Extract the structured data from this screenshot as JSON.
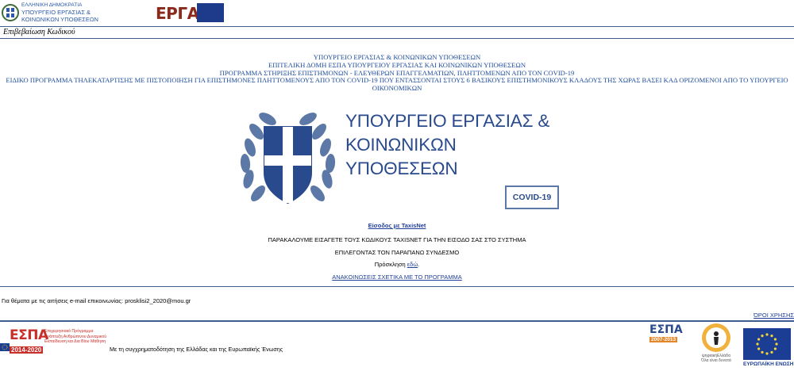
{
  "header": {
    "ministry_line1": "ΕΛΛΗΝΙΚΗ ΔΗΜΟΚΡΑΤΙΑ",
    "ministry_line2": "ΥΠΟΥΡΓΕΙΟ ΕΡΓΑΣΙΑΣ &",
    "ministry_line3": "ΚΟΙΝΩΝΙΚΩΝ ΥΠΟΘΕΣΕΩΝ",
    "ergani_logo_text": "ΕΡΓΑΝΗ"
  },
  "page_heading": "Επιβεβαίωση Κωδικού",
  "titles": {
    "line1": "ΥΠΟΥΡΓΕΙΟ ΕΡΓΑΣΙΑΣ & ΚΟΙΝΩΝΙΚΩΝ ΥΠΟΘΕΣΕΩΝ",
    "line2": "ΕΠΙΤΕΛΙΚΗ ΔΟΜΗ ΕΣΠΑ ΥΠΟΥΡΓΕΙΟΥ ΕΡΓΑΣΙΑΣ ΚΑΙ ΚΟΙΝΩΝΙΚΩΝ ΥΠΟΘΕΣΕΩΝ",
    "line3": "ΠΡΟΓΡΑΜΜΑ ΣΤΗΡΙΞΗΣ ΕΠΙΣΤΗΜΟΝΩΝ - ΕΛΕΥΘΕΡΩΝ ΕΠΑΓΓΕΛΜΑΤΙΩΝ, ΠΛΗΤΤΟΜΕΝΩΝ ΑΠΟ ΤΟΝ COVID-19",
    "line4": "ΕΙΔΙΚΟ ΠΡΟΓΡΑΜΜΑ ΤΗΛΕΚΑΤΑΡΤΙΣΗΣ ΜΕ ΠΙΣΤΟΠΟΙΗΣΗ ΓΙΑ ΕΠΙΣΤΗΜΟΝΕΣ ΠΛΗΤΤΟΜΕΝΟΥΣ ΑΠΟ ΤΟΝ COVID-19 ΠΟΥ ΕΝΤΑΣΣΟΝΤΑΙ ΣΤΟΥΣ 6 ΒΑΣΙΚΟΥΣ ΕΠΙΣΤΗΜΟΝΙΚΟΥΣ ΚΛΑΔΟΥΣ ΤΗΣ ΧΩΡΑΣ ΒΑΣΕΙ ΚΑΔ ΟΡΙΖΟΜΕΝΟΙ ΑΠΟ ΤΟ ΥΠΟΥΡΓΕΙΟ ΟΙΚΟΝΟΜΙΚΩΝ"
  },
  "banner": {
    "ministry_line1": "ΥΠΟΥΡΓΕΙΟ ΕΡΓΑΣΙΑΣ &",
    "ministry_line2": "ΚΟΙΝΩΝΙΚΩΝ ΥΠΟΘΕΣΕΩΝ",
    "covid_badge": "COVID-19"
  },
  "main": {
    "login_link": "Είσοδος με TaxisNet",
    "instruction_line1": "ΠΑΡΑΚΑΛΟΥΜΕ ΕΙΣΑΓΕΤΕ ΤΟΥΣ ΚΩΔΙΚΟΥΣ TAXISNET ΓΙΑ ΤΗΝ ΕΙΣΟΔΟ ΣΑΣ ΣΤΟ ΣΥΣΤΗΜΑ",
    "instruction_line2": "ΕΠΙΛΕΓΟΝΤΑΣ ΤΟΝ ΠΑΡΑΠΑΝΩ ΣΥΝΔΕΣΜΟ",
    "invitation_label": "Πρόσκληση",
    "invitation_link": "εδώ",
    "invitation_suffix": ".",
    "announcements_link": "ΑΝΑΚΟΙΝΩΣΕΙΣ ΣΧΕΤΙΚΑ ΜΕ ΤΟ ΠΡΟΓΡΑΜΜΑ"
  },
  "contact_text": "Για θέματα με τις αιτήσεις e-mail επικοινωνίας: prosklisi2_2020@mou.gr",
  "terms_link": "ΌΡΟΙ ΧΡΗΣΗΣ",
  "footer": {
    "espa_logo_word": "ΕΣΠΑ",
    "espa_logo_years": "2014-2020",
    "espa_logo_tagline_line1": "Επιχειρησιακό Πρόγραμμα",
    "espa_logo_tagline_line2": "Ανάπτυξη Ανθρώπινου Δυναμικού",
    "espa_logo_tagline_line3": "Εκπαίδευση και Δια Βίου Μάθηση",
    "cofunding_text": "Με τη συγχρηματοδότηση της Ελλάδας και της Ευρωπαϊκής Ένωσης",
    "espa2_logo_word": "ΕΣΠΑ",
    "espa2_logo_years": "2007-2013",
    "digital_greece_line1": "ψηφιακήΕλλάδα",
    "digital_greece_line2": "Όλα είναι δυνατά",
    "eu_label": "ΕΥΡΩΠΑΪΚΗ ΕΝΩΣΗ"
  },
  "colors": {
    "header_blue": "#1e3a8a",
    "title_blue": "#1f4e9c",
    "link_blue": "#1f3f98",
    "ergani_red": "#8b2a1c",
    "espa_red": "#c92f2a",
    "rule_blue": "#3f5c8f"
  }
}
